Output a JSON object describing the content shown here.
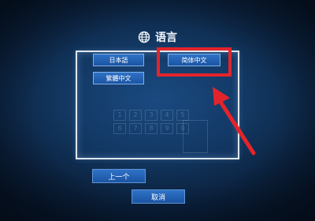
{
  "dialog": {
    "title": "语言",
    "title_icon": "globe-icon"
  },
  "languages": [
    {
      "label": "日本語"
    },
    {
      "label": "简体中文",
      "highlighted": true
    },
    {
      "label": "繁體中文"
    }
  ],
  "buttons": {
    "previous": "上一个",
    "cancel": "取消"
  },
  "background_panel": {
    "keypad_keys": [
      "1",
      "2",
      "3",
      "4",
      "5",
      "6",
      "7",
      "8",
      "9",
      "0"
    ]
  },
  "colors": {
    "annotation": "#e3242b",
    "button": "#2064b5",
    "background": "#12365f"
  }
}
